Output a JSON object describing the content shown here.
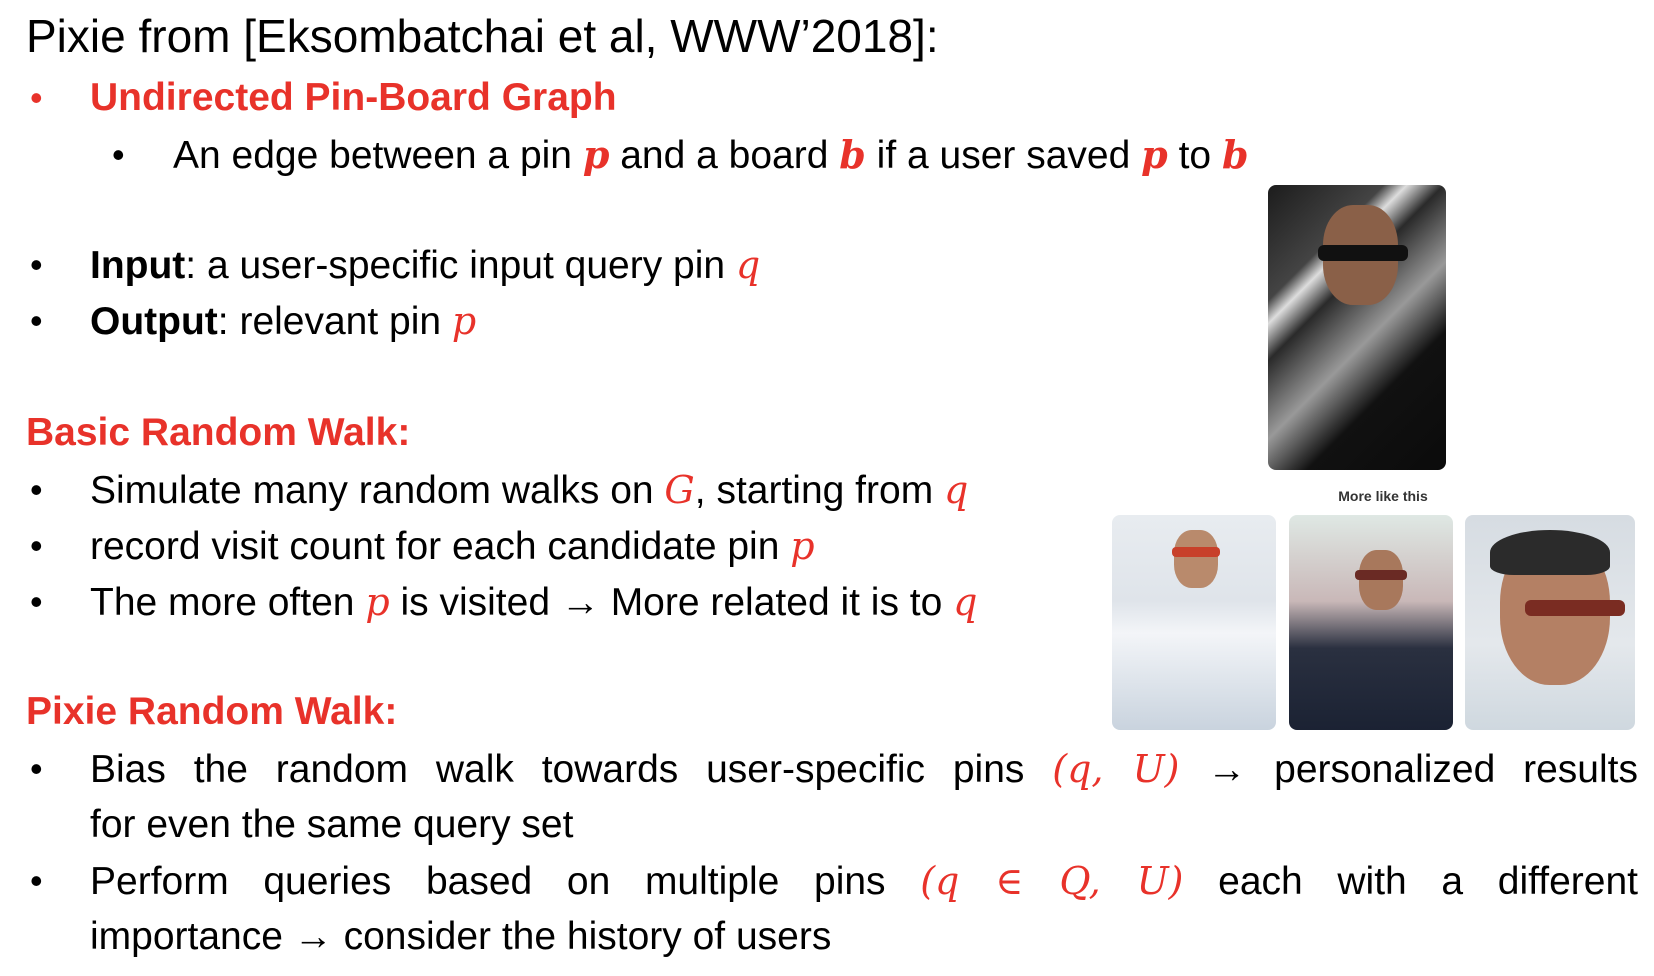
{
  "title": "Pixie from [Eksombatchai et al, WWW’2018]:",
  "bullet_char": "•",
  "section1": {
    "heading": "Undirected Pin-Board Graph",
    "sub": {
      "t1": "An edge between a pin ",
      "p": "p",
      "t2": " and a board ",
      "b": "b",
      "t3": " if a user saved ",
      "p2": "p",
      "t4": " to ",
      "b2": "b"
    }
  },
  "input": {
    "label": "Input",
    "text": ": a user-specific input query pin ",
    "var": "q"
  },
  "output": {
    "label": "Output",
    "text": ": relevant pin ",
    "var": "p"
  },
  "basic": {
    "heading": "Basic Random Walk:",
    "b1": {
      "t1": "Simulate many random walks on ",
      "G": "G",
      "t2": ", starting from ",
      "q": "q"
    },
    "b2": {
      "t1": "record visit count for each candidate pin ",
      "p": "p"
    },
    "b3": {
      "t1": "The more often ",
      "p": "p",
      "t2": " is visited → More related it is to ",
      "q": "q"
    }
  },
  "pixie": {
    "heading": "Pixie Random Walk:",
    "b1": {
      "t1": "Bias the random walk towards user-specific pins ",
      "math": "(q, U)",
      "t2": " → personalized results",
      "t3": "for even the same query set"
    },
    "b2": {
      "t1": "Perform queries based on multiple pins ",
      "math": "(q ∈ Q, U)",
      "t2": " each with a different",
      "t3": "importance → consider the history of users"
    }
  },
  "figure": {
    "caption": "More like this"
  },
  "colors": {
    "accent": "#e8322a"
  }
}
